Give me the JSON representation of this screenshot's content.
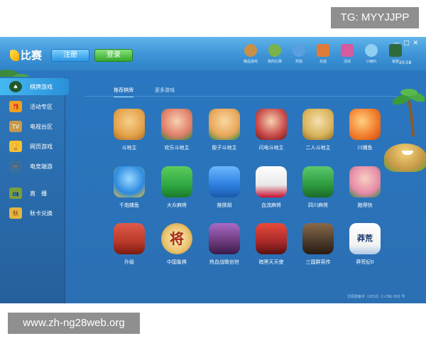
{
  "overlay": {
    "tg_text": "TG: MYYJJPP",
    "site_text": "www.zh-ng28web.org"
  },
  "titlebar": {
    "logo_text": "比赛",
    "register_label": "注册",
    "login_label": "登录",
    "clock": "20:58",
    "nav": [
      {
        "label": "精品游戏",
        "icon": "treasure-icon",
        "color": "#c9904a"
      },
      {
        "label": "我的比赛",
        "icon": "character-icon",
        "color": "#7bb24a"
      },
      {
        "label": "奖励",
        "icon": "bird-icon",
        "color": "#5aa0e0"
      },
      {
        "label": "充值",
        "icon": "bag-icon",
        "color": "#e07a3a"
      },
      {
        "label": "活动",
        "icon": "gift-icon",
        "color": "#d35b9e"
      },
      {
        "label": "小喇叭",
        "icon": "bird2-icon",
        "color": "#8fd0f0"
      },
      {
        "label": "客服",
        "icon": "bell-icon",
        "color": "#2d6a3e"
      }
    ]
  },
  "sidebar": {
    "items": [
      {
        "label": "棋牌游戏",
        "icon": "spade-icon",
        "color": "#2a6a3a",
        "active": true
      },
      {
        "label": "活动专区",
        "icon": "gift-icon",
        "color": "#f0a020",
        "active": false
      },
      {
        "label": "电视台区",
        "icon": "tv-icon",
        "color": "#c59a4a",
        "active": false
      },
      {
        "label": "网页游戏",
        "icon": "trophy-icon",
        "color": "#f4c030",
        "active": false
      },
      {
        "label": "电竞端游",
        "icon": "gamepad-icon",
        "color": "#3a6e9e",
        "active": false
      },
      {
        "label": "直　播",
        "icon": "tv-live-icon",
        "color": "#7a9e3a",
        "active": false
      },
      {
        "label": "秋卡兑换",
        "icon": "card-icon",
        "color": "#e2b640",
        "active": false
      }
    ]
  },
  "tabs": [
    {
      "label": "推荐棋牌",
      "active": true
    },
    {
      "label": "更多游戏",
      "active": false
    }
  ],
  "games": [
    {
      "label": "斗地主",
      "color": "#e3a24a"
    },
    {
      "label": "欢乐斗地主",
      "color": "#e07e6a"
    },
    {
      "label": "骰子斗地主",
      "color": "#e9a65a"
    },
    {
      "label": "闪电斗地主",
      "color": "#c84a4a"
    },
    {
      "label": "二人斗地主",
      "color": "#d8b35a"
    },
    {
      "label": "川捕鱼",
      "color": "#f07a2a"
    },
    {
      "label": "千炮捕鱼",
      "color": "#2c8ae0"
    },
    {
      "label": "大众麻将",
      "color": "#2fa844"
    },
    {
      "label": "推倒胡",
      "color": "#2c7ee0"
    },
    {
      "label": "血流麻将",
      "color": "#e8e8e8"
    },
    {
      "label": "四川麻将",
      "color": "#2e9a3e"
    },
    {
      "label": "跑得快",
      "color": "#e68aa8"
    },
    {
      "label": "升级",
      "color": "#b83a2a"
    },
    {
      "label": "中国象棋",
      "color": "#e8c06a"
    },
    {
      "label": "热血战歌创世",
      "color": "#6a3a7a"
    },
    {
      "label": "暗黑天天使",
      "color": "#a82a2a"
    },
    {
      "label": "三国群英传",
      "color": "#4a3a2a"
    },
    {
      "label": "莽荒纪II",
      "color": "#f2f2f2"
    }
  ],
  "footer": "文网游备字〔2010〕C-CBG 002 号"
}
